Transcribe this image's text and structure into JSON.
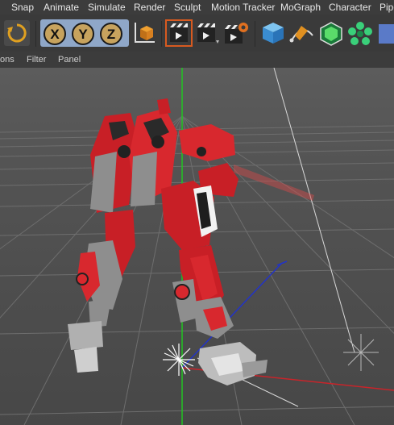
{
  "menu": [
    "Snap",
    "Animate",
    "Simulate",
    "Render",
    "Sculpt",
    "Motion Tracker",
    "MoGraph",
    "Character",
    "Pipe"
  ],
  "toolbar": {
    "axes": [
      "X",
      "Y",
      "Z"
    ]
  },
  "subbar": [
    "ons",
    "Filter",
    "Panel"
  ],
  "colors": {
    "menubar": "#3c3c3c",
    "toolbar": "#3a3a3a",
    "viewport": "#5a5a5a",
    "robot_red": "#d8282e",
    "robot_gray": "#8e8e8e",
    "axis_green": "#22c322",
    "axis_red": "#c8242a",
    "axis_blue": "#2233c8"
  }
}
